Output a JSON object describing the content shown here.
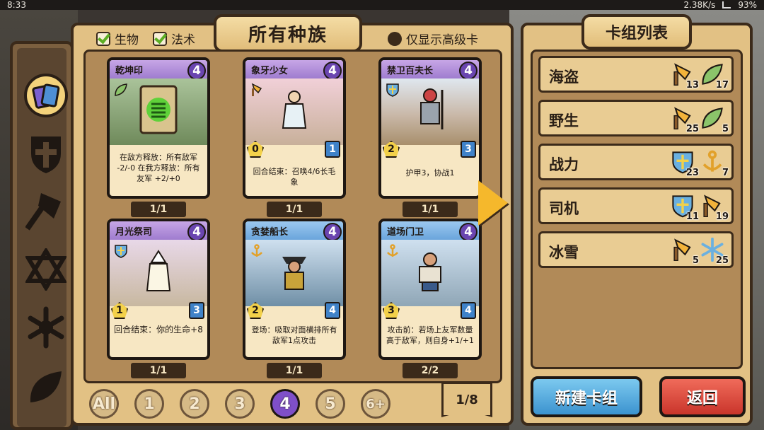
{
  "status_bar": {
    "time": "8:33",
    "net_speed": "2.38K/s",
    "battery": "93%"
  },
  "main": {
    "title": "所有种族",
    "filters": [
      {
        "label": "生物",
        "checked": true
      },
      {
        "label": "法术",
        "checked": true
      },
      {
        "label": "仅显示高级卡",
        "checked": false
      }
    ],
    "cards": [
      {
        "name": "乾坤印",
        "cost": "4",
        "race": "nature",
        "text": "在敌方释放：所有敌军 -2/-0 在我方释放：所有友军 +2/+0",
        "count": "1/1",
        "is_spell": true
      },
      {
        "name": "象牙少女",
        "cost": "4",
        "race": "axe",
        "attack": "0",
        "health": "1",
        "text": "回合结束：召唤4/6长毛象",
        "count": "1/1"
      },
      {
        "name": "禁卫百夫长",
        "cost": "4",
        "race": "shield",
        "attack": "2",
        "health": "3",
        "text": "护甲3，协战1",
        "count": "1/1"
      },
      {
        "name": "月光祭司",
        "cost": "4",
        "race": "shield",
        "attack": "1",
        "health": "3",
        "text": "回合结束：你的生命+8",
        "count": "1/1"
      },
      {
        "name": "贪婪船长",
        "cost": "4",
        "race": "anchor",
        "attack": "2",
        "health": "4",
        "text": "登场：吸取对面横排所有敌军1点攻击",
        "count": "1/1"
      },
      {
        "name": "道场门卫",
        "cost": "4",
        "race": "anchor",
        "attack": "3",
        "health": "4",
        "text": "攻击前：若场上友军数量高于敌军，则自身+1/+1",
        "count": "2/2"
      }
    ],
    "pages": [
      "All",
      "1",
      "2",
      "3",
      "4",
      "5",
      "6+"
    ],
    "active_page": "4",
    "page_indicator": "1/8"
  },
  "decks_panel": {
    "title": "卡组列表",
    "decks": [
      {
        "name": "海盗",
        "icons": [
          {
            "type": "axe",
            "count": "13"
          },
          {
            "type": "nature",
            "count": "17"
          }
        ]
      },
      {
        "name": "野生",
        "icons": [
          {
            "type": "axe",
            "count": "25"
          },
          {
            "type": "nature",
            "count": "5"
          }
        ]
      },
      {
        "name": "战力",
        "icons": [
          {
            "type": "shield",
            "count": "23"
          },
          {
            "type": "anchor",
            "count": "7"
          }
        ]
      },
      {
        "name": "司机",
        "icons": [
          {
            "type": "shield",
            "count": "11"
          },
          {
            "type": "axe",
            "count": "19"
          }
        ]
      },
      {
        "name": "冰雪",
        "icons": [
          {
            "type": "axe",
            "count": "5"
          },
          {
            "type": "snowflake",
            "count": "25"
          }
        ]
      }
    ],
    "new_deck_label": "新建卡组",
    "back_label": "返回"
  },
  "colors": {
    "panel": "#e2c184",
    "border": "#3b2a1a",
    "cost": "#6a45b0",
    "health": "#3f82c8",
    "attack": "#f3d14a",
    "accent_arrow": "#f5b82c"
  }
}
